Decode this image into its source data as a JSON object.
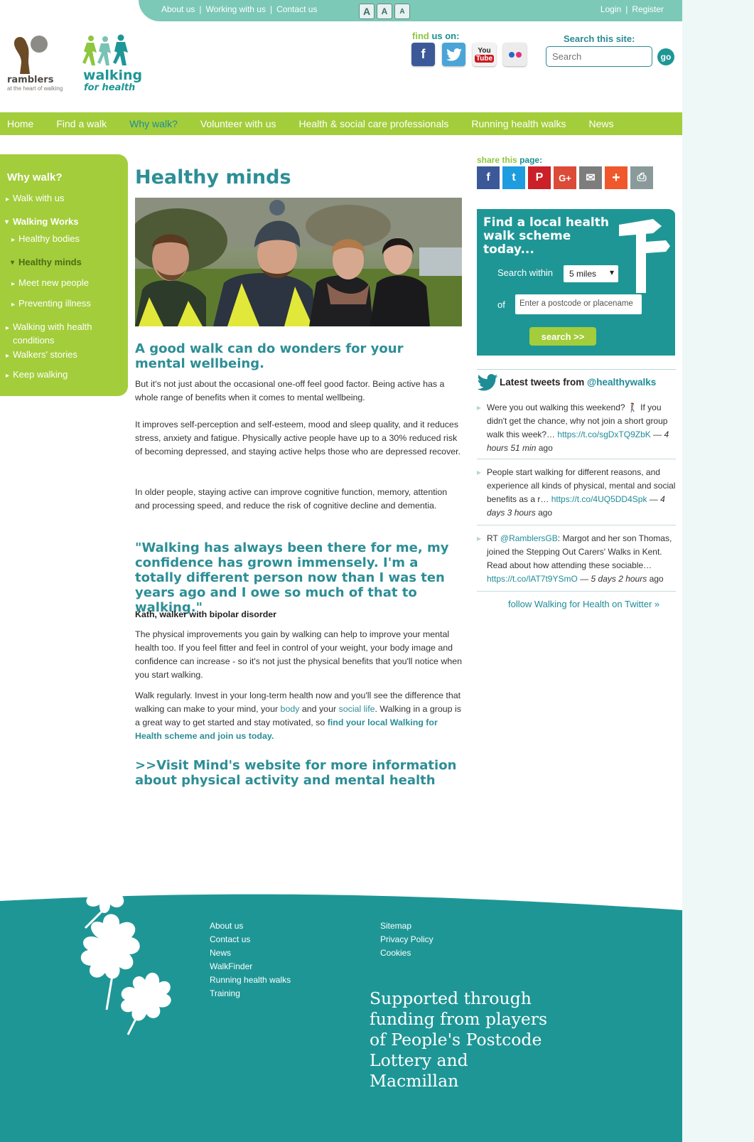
{
  "topbar": {
    "links": [
      "About us",
      "Working with us",
      "Contact us"
    ],
    "textsize": [
      "A",
      "A",
      "A"
    ],
    "login": "Login",
    "register": "Register"
  },
  "header": {
    "ramblers_name": "ramblers",
    "ramblers_tagline": "at the heart of walking",
    "wfh_line1": "walking",
    "wfh_line2": "for health",
    "findus_a": "find",
    "findus_b": "us on:",
    "social": [
      {
        "name": "facebook-icon",
        "glyph": "f",
        "color": "#3b5998"
      },
      {
        "name": "twitter-icon",
        "glyph": "t",
        "color": "#4aa4d8"
      },
      {
        "name": "youtube-icon",
        "glyph": "You Tube",
        "color": "#b31217"
      },
      {
        "name": "flickr-icon",
        "glyph": "●●",
        "color": "#e8e8e8"
      }
    ],
    "search_label": "Search this site:",
    "search_placeholder": "Search",
    "go_label": "go"
  },
  "mainnav": [
    {
      "label": "Home",
      "active": false
    },
    {
      "label": "Find a walk",
      "active": false
    },
    {
      "label": "Why walk?",
      "active": true
    },
    {
      "label": "Volunteer with us",
      "active": false
    },
    {
      "label": "Health & social care professionals",
      "active": false
    },
    {
      "label": "Running health walks",
      "active": false
    },
    {
      "label": "News",
      "active": false
    }
  ],
  "leftnav": {
    "title": "Why walk?",
    "items": [
      "Walk with us",
      "Walking Works",
      "Healthy bodies",
      "Healthy minds",
      "Meet new people",
      "Preventing illness",
      "Walking with health conditions",
      "Walkers' stories",
      "Keep walking"
    ]
  },
  "content": {
    "title": "Healthy minds",
    "intro": "A good walk can do wonders for your mental wellbeing.",
    "p1": "But it's not just about the occasional one-off feel good factor. Being active has a whole range of benefits when it comes to mental wellbeing.",
    "p2": "It improves self-perception and self-esteem, mood and sleep quality, and it reduces stress, anxiety and fatigue. Physically active people have up to a 30% reduced risk of becoming depressed, and staying active helps those who are depressed recover.",
    "p3": "In older people, staying active can improve cognitive function, memory, attention and processing speed, and reduce the risk of cognitive decline and dementia.",
    "quote": "\"Walking has always been there for me, my confidence has grown immensely. I'm a totally different person now than I was ten years ago and I owe so much of that to walking.\"",
    "attribution": "Kath, walker with bipolar disorder",
    "p4": "The physical improvements you gain by walking can help to improve your mental health too. If you feel fitter and feel in control of your weight, your body image and confidence can increase - so it's not just the physical benefits that you'll notice when you start walking.",
    "p5_a": "Walk regularly. Invest in your long-term health now and you'll see the difference that walking can make to your mind, your",
    "p5_body": "body",
    "p5_b": "and your",
    "p5_social": "social life",
    "p5_c": ". Walking in a group is a great way to get started and stay motivated, so",
    "p5_link": "find your local Walking for Health scheme and join us today.",
    "mind_link": ">>Visit Mind's website for more information about physical activity and mental health"
  },
  "share": {
    "label_a": "share",
    "label_b": "this",
    "label_c": "page:",
    "icons": [
      {
        "name": "facebook-share-icon",
        "glyph": "f",
        "color": "#3b5998"
      },
      {
        "name": "twitter-share-icon",
        "glyph": "t",
        "color": "#1d9ce0"
      },
      {
        "name": "pinterest-share-icon",
        "glyph": "P",
        "color": "#cb2027"
      },
      {
        "name": "googleplus-share-icon",
        "glyph": "G+",
        "color": "#dc4a38"
      },
      {
        "name": "email-share-icon",
        "glyph": "✉",
        "color": "#7d7d7d"
      },
      {
        "name": "more-share-icon",
        "glyph": "+",
        "color": "#f0572b"
      },
      {
        "name": "print-share-icon",
        "glyph": "⎙",
        "color": "#8a9a9a"
      }
    ]
  },
  "findbox": {
    "heading": "Find a local health walk scheme today...",
    "search_within": "Search within",
    "radius": "5 miles",
    "of": "of",
    "postcode_placeholder": "Enter a postcode or placename",
    "button": "search >>"
  },
  "tweets": {
    "heading": "Latest tweets from",
    "handle": "@healthywalks",
    "items": [
      {
        "text": "Were you out walking this weekend? 🚶‍♀️ If you didn't get the chance, why not join a short group walk this week?…",
        "link": "https://t.co/sgDxTQ9ZbK",
        "time": "— 4 hours 51 min",
        "ago": "ago"
      },
      {
        "text": "People start walking for different reasons, and experience all kinds of physical, mental and social benefits as a r…",
        "link": "https://t.co/4UQ5DD4Spk",
        "time": "— 4 days 3 hours",
        "ago": "ago"
      },
      {
        "pre": "RT",
        "mention": "@RamblersGB",
        "text": ": Margot and her son Thomas, joined the Stepping Out Carers' Walks in Kent. Read about how attending these sociable…",
        "link": "https://t.co/lAT7t9YSmO",
        "time": "— 5 days 2 hours",
        "ago": "ago"
      }
    ],
    "follow": "follow Walking for Health on Twitter »"
  },
  "footer": {
    "col1": [
      "About us",
      "Contact us",
      "News",
      "WalkFinder",
      "Running health walks",
      "Training"
    ],
    "col2": [
      "Sitemap",
      "Privacy Policy",
      "Cookies"
    ],
    "support": "Supported through funding from players of People's Postcode Lottery and Macmillan"
  },
  "colors": {
    "teal": "#1f9696",
    "green": "#a3cd3b",
    "link": "#2d8e96"
  }
}
